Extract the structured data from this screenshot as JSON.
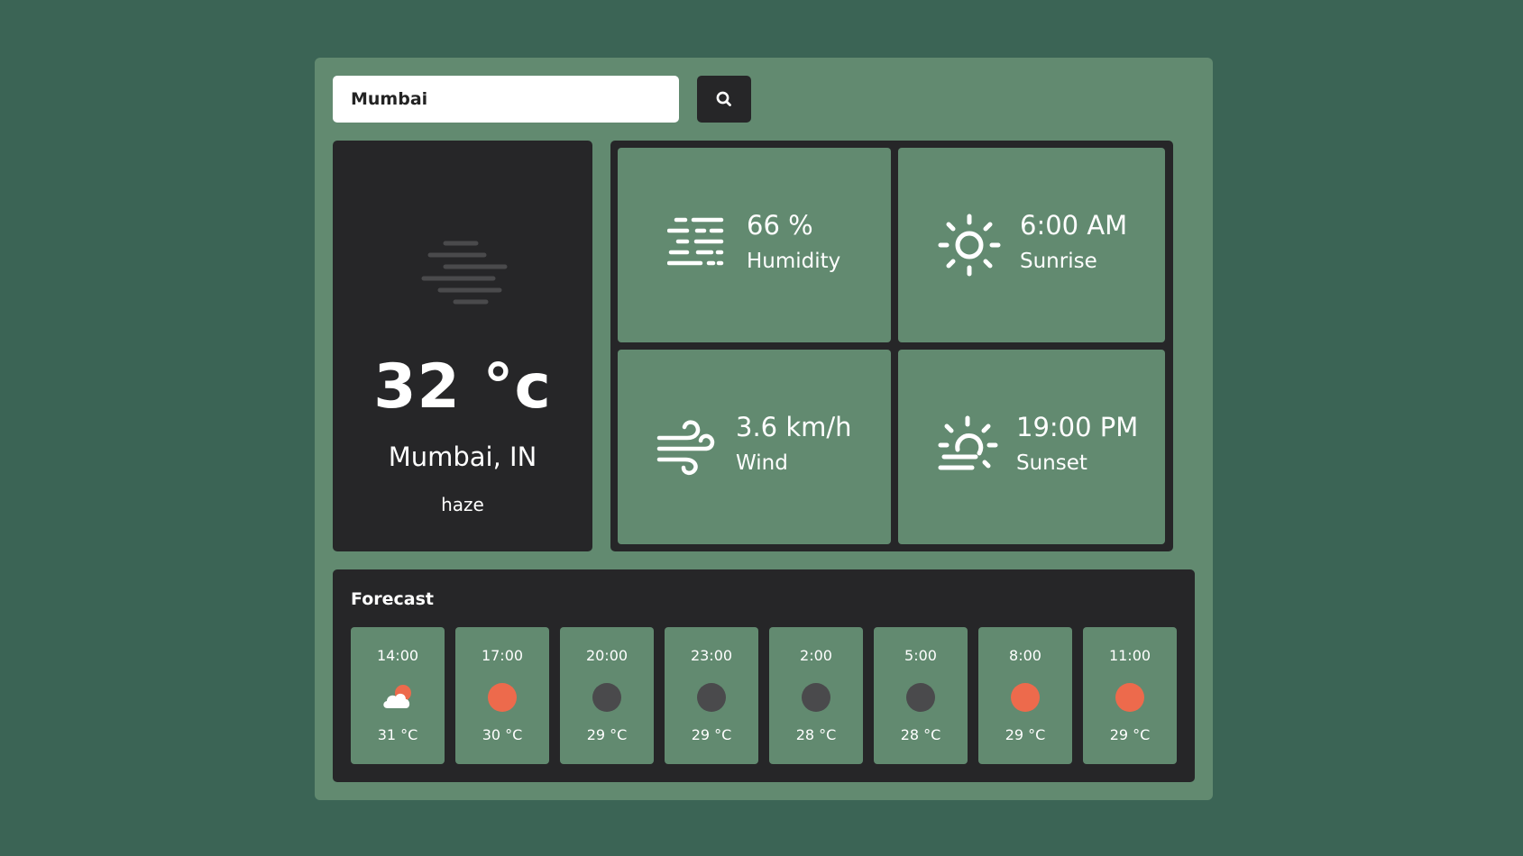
{
  "search": {
    "value": "Mumbai",
    "button_icon": "search-icon"
  },
  "current": {
    "icon": "haze-icon",
    "temperature": "32 °c",
    "location": "Mumbai, IN",
    "description": "haze"
  },
  "details": {
    "humidity": {
      "value": "66 %",
      "label": "Humidity",
      "icon": "humidity-icon"
    },
    "sunrise": {
      "value": "6:00 AM",
      "label": "Sunrise",
      "icon": "sunrise-icon"
    },
    "wind": {
      "value": "3.6 km/h",
      "label": "Wind",
      "icon": "wind-icon"
    },
    "sunset": {
      "value": "19:00 PM",
      "label": "Sunset",
      "icon": "sunset-icon"
    }
  },
  "forecast": {
    "title": "Forecast",
    "items": [
      {
        "time": "14:00",
        "icon": "partly-cloudy-day-icon",
        "temp": "31 °C"
      },
      {
        "time": "17:00",
        "icon": "sun-icon",
        "temp": "30 °C"
      },
      {
        "time": "20:00",
        "icon": "moon-icon",
        "temp": "29 °C"
      },
      {
        "time": "23:00",
        "icon": "moon-icon",
        "temp": "29 °C"
      },
      {
        "time": "2:00",
        "icon": "moon-icon",
        "temp": "28 °C"
      },
      {
        "time": "5:00",
        "icon": "moon-icon",
        "temp": "28 °C"
      },
      {
        "time": "8:00",
        "icon": "sun-icon",
        "temp": "29 °C"
      },
      {
        "time": "11:00",
        "icon": "sun-icon",
        "temp": "29 °C"
      }
    ]
  },
  "colors": {
    "page_background": "#3b6455",
    "panel": "#628a70",
    "dark_card": "#262628",
    "sun": "#ed6a4c",
    "moon": "#4a4a4c"
  }
}
